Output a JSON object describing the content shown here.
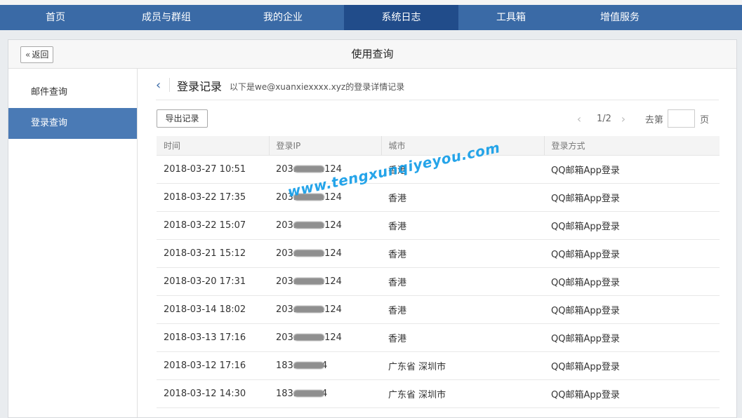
{
  "nav": {
    "items": [
      {
        "label": "首页",
        "width": 158
      },
      {
        "label": "成员与群组",
        "width": 158
      },
      {
        "label": "我的企业",
        "width": 174
      },
      {
        "label": "系统日志",
        "width": 163
      },
      {
        "label": "工具箱",
        "width": 150
      },
      {
        "label": "增值服务",
        "width": 160
      }
    ],
    "active_index": 3
  },
  "panel": {
    "back_label": "返回",
    "title": "使用查询"
  },
  "sidebar": {
    "items": [
      {
        "label": "邮件查询"
      },
      {
        "label": "登录查询"
      }
    ]
  },
  "content": {
    "title": "登录记录",
    "desc": "以下是we@xuanxiexxxx.xyz的登录详情记录",
    "export_label": "导出记录",
    "pager": {
      "indicator": "1/2",
      "goto_label": "去第",
      "unit_label": "页"
    },
    "table": {
      "headers": [
        "时间",
        "登录IP",
        "城市",
        "登录方式"
      ],
      "rows": [
        {
          "time": "2018-03-27 10:51",
          "ip_prefix": "203.",
          "ip_suffix": ".124",
          "city": "香港",
          "method": "QQ邮箱App登录"
        },
        {
          "time": "2018-03-22 17:35",
          "ip_prefix": "203.",
          "ip_suffix": ".124",
          "city": "香港",
          "method": "QQ邮箱App登录"
        },
        {
          "time": "2018-03-22 15:07",
          "ip_prefix": "203.",
          "ip_suffix": ".124",
          "city": "香港",
          "method": "QQ邮箱App登录"
        },
        {
          "time": "2018-03-21 15:12",
          "ip_prefix": "203.",
          "ip_suffix": ".124",
          "city": "香港",
          "method": "QQ邮箱App登录"
        },
        {
          "time": "2018-03-20 17:31",
          "ip_prefix": "203.",
          "ip_suffix": ".124",
          "city": "香港",
          "method": "QQ邮箱App登录"
        },
        {
          "time": "2018-03-14 18:02",
          "ip_prefix": "203.",
          "ip_suffix": ".124",
          "city": "香港",
          "method": "QQ邮箱App登录"
        },
        {
          "time": "2018-03-13 17:16",
          "ip_prefix": "203.",
          "ip_suffix": ".124",
          "city": "香港",
          "method": "QQ邮箱App登录"
        },
        {
          "time": "2018-03-12 17:16",
          "ip_prefix": "183.",
          "ip_suffix": "4",
          "city": "广东省 深圳市",
          "method": "QQ邮箱App登录"
        },
        {
          "time": "2018-03-12 14:30",
          "ip_prefix": "183.",
          "ip_suffix": "4",
          "city": "广东省 深圳市",
          "method": "QQ邮箱App登录"
        }
      ]
    }
  },
  "watermark": "www.tengxunqiyeyou.com",
  "colors": {
    "nav_bg": "#3a6aa6",
    "nav_active": "#214c8a",
    "sidebar_active": "#4a7ab5",
    "watermark": "#1aa0e8"
  }
}
